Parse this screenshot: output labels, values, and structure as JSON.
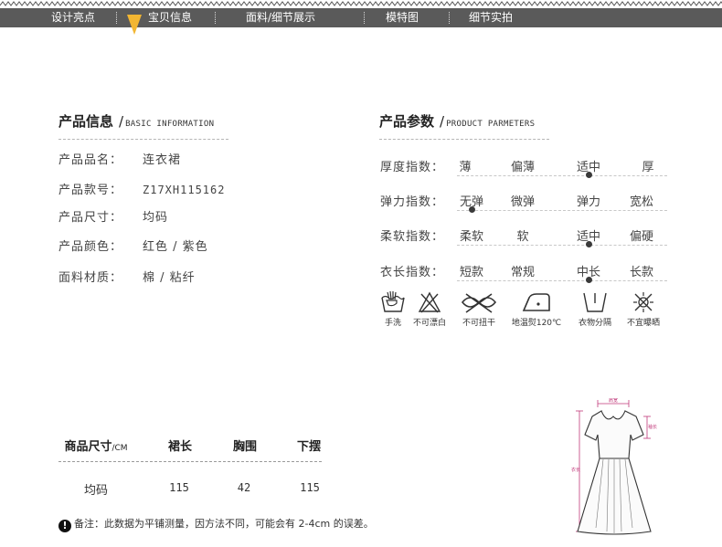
{
  "nav": {
    "items": [
      {
        "label": "设计亮点"
      },
      {
        "label": "宝贝信息"
      },
      {
        "label": "面料/细节展示"
      },
      {
        "label": "模特图"
      },
      {
        "label": "细节实拍"
      }
    ],
    "active_index": 1,
    "colors": {
      "bar": "#5a5a5a",
      "marker": "#f2b632"
    }
  },
  "product_info": {
    "title": "产品信息",
    "subtitle": "BASIC INFORMATION",
    "rows": [
      {
        "label": "产品品名：",
        "value": "连衣裙"
      },
      {
        "label": "产品款号：",
        "value": "Z17XH115162"
      },
      {
        "label": "产品尺寸：",
        "value": "均码"
      },
      {
        "label": "产品颜色：",
        "value": "红色 / 紫色"
      },
      {
        "label": "面料材质：",
        "value": "棉 / 粘纤"
      }
    ]
  },
  "product_params": {
    "title": "产品参数",
    "subtitle": "PRODUCT PARMETERS",
    "rows": [
      {
        "label": "厚度指数：",
        "options": [
          "薄",
          "偏薄",
          "适中",
          "厚"
        ],
        "selected_index": 2
      },
      {
        "label": "弹力指数：",
        "options": [
          "无弹",
          "微弹",
          "弹力",
          "宽松"
        ],
        "selected_index": 0
      },
      {
        "label": "柔软指数：",
        "options": [
          "柔软",
          "软",
          "适中",
          "偏硬"
        ],
        "selected_index": 2
      },
      {
        "label": "衣长指数：",
        "options": [
          "短款",
          "常规",
          "中长",
          "长款"
        ],
        "selected_index": 2
      }
    ]
  },
  "care": [
    {
      "icon": "hand-wash-icon",
      "label": "手洗"
    },
    {
      "icon": "no-bleach-icon",
      "label": "不可漂白"
    },
    {
      "icon": "no-wring-icon",
      "label": "不可扭干"
    },
    {
      "icon": "low-iron-icon",
      "label": "地温熨120℃"
    },
    {
      "icon": "wash-separately-icon",
      "label": "衣物分隔"
    },
    {
      "icon": "no-sun-dry-icon",
      "label": "不宜曝晒"
    }
  ],
  "size_table": {
    "header_label": "商品尺寸",
    "unit": "/CM",
    "columns": [
      "裙长",
      "胸围",
      "下摆"
    ],
    "rows": [
      {
        "size": "均码",
        "values": [
          "115",
          "42",
          "115"
        ]
      }
    ]
  },
  "note": {
    "text": "备注：此数据为平铺测量，因方法不同，可能会有 2-4cm 的误差。"
  },
  "diagram": {
    "labels": {
      "shoulder": "肩宽",
      "chest": "胸围",
      "length": "衣长",
      "sleeve": "袖长"
    },
    "accent_color": "#c0397a"
  }
}
